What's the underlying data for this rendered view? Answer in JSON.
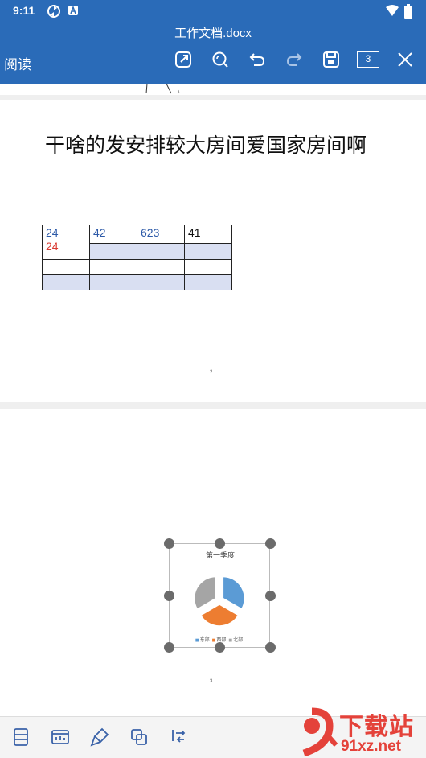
{
  "status_bar": {
    "time": "9:11"
  },
  "app_bar": {
    "title": "工作文档.docx",
    "mode_label": "阅读",
    "page_count": "3",
    "icons": [
      "edit-icon",
      "search-icon",
      "undo-icon",
      "redo-icon",
      "save-icon",
      "page-count-icon",
      "close-icon"
    ]
  },
  "page2": {
    "heading": "干啥的发安排较大房间爱国家房间啊",
    "table": {
      "rows": [
        [
          [
            "24",
            "24"
          ],
          [
            "42"
          ],
          [
            "623"
          ],
          [
            "41"
          ]
        ],
        [
          [
            ""
          ],
          [
            ""
          ],
          [
            ""
          ],
          [
            ""
          ]
        ],
        [
          [
            ""
          ],
          [
            ""
          ],
          [
            ""
          ],
          [
            ""
          ]
        ]
      ]
    },
    "page_number": "2"
  },
  "page3": {
    "chart_data": {
      "type": "pie",
      "title": "第一季度",
      "categories": [
        "东部",
        "西部",
        "北部"
      ],
      "values": [
        33.3,
        33.3,
        33.4
      ],
      "colors": [
        "#5b9bd5",
        "#ed7d31",
        "#a5a5a5"
      ],
      "legend": [
        "东部",
        "西部",
        "北部"
      ],
      "legend_placement": "bottom"
    },
    "page_number": "3"
  },
  "bottom_bar": {
    "icons": [
      "layout-icon",
      "view-icon",
      "brush-icon",
      "copy-icon",
      "swap-icon"
    ]
  },
  "watermark": {
    "main": "下载站",
    "url": "91xz.net"
  }
}
